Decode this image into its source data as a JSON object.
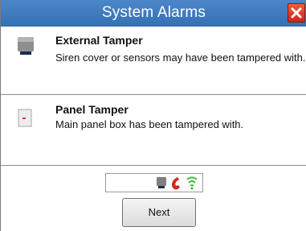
{
  "window": {
    "title": "System Alarms",
    "title_bar_color": "#3a78bd",
    "close_icon": "close-icon"
  },
  "alarms": [
    {
      "icon": "siren-icon",
      "title": "External Tamper",
      "description": "Siren cover or sensors may have been tampered with."
    },
    {
      "icon": "panel-box-icon",
      "title": "Panel Tamper",
      "description": "Main panel box has been tampered with."
    }
  ],
  "status_icons": [
    "siren-icon",
    "phone-icon",
    "signal-icon"
  ],
  "buttons": {
    "next_label": "Next"
  }
}
